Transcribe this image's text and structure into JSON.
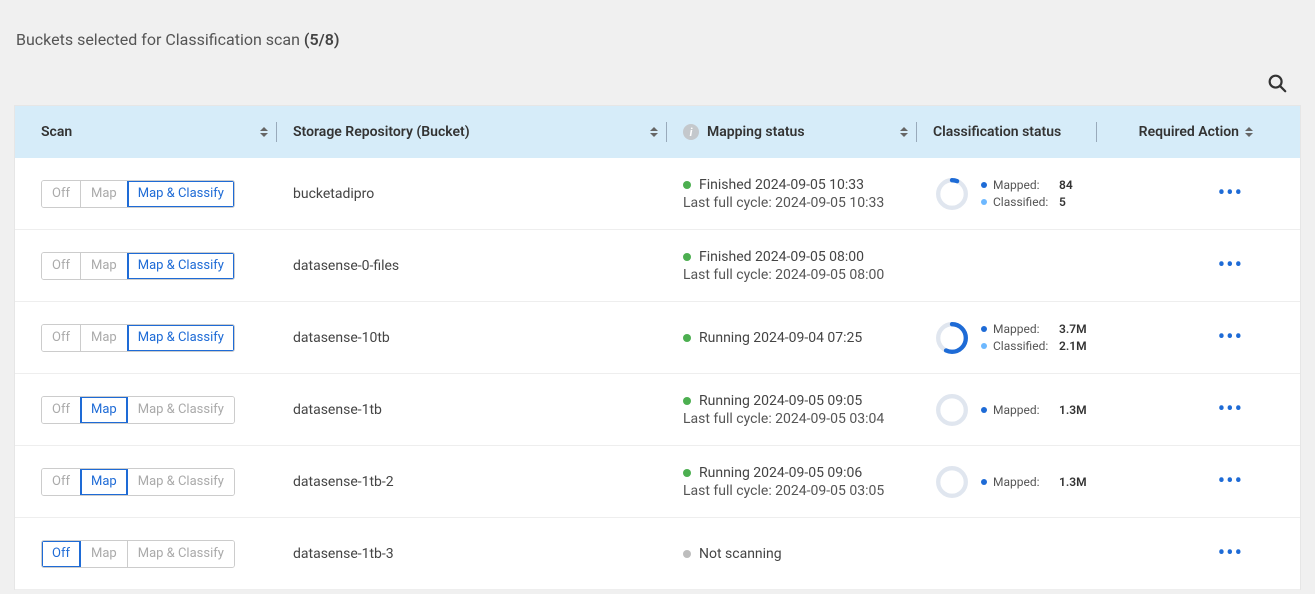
{
  "header": {
    "title_prefix": "Buckets selected for Classification scan ",
    "count": "(5/8)"
  },
  "columns": {
    "scan": "Scan",
    "repo": "Storage Repository (Bucket)",
    "map": "Mapping status",
    "class": "Classification status",
    "action": "Required Action"
  },
  "scan_labels": {
    "off": "Off",
    "map": "Map",
    "map_classify": "Map & Classify"
  },
  "status_words": {
    "finished": "Finished",
    "running": "Running",
    "not_scanning": "Not scanning",
    "last_full_cycle": "Last full cycle:"
  },
  "stat_labels": {
    "mapped": "Mapped:",
    "classified": "Classified:"
  },
  "rows": [
    {
      "mode": "map_classify",
      "bucket": "bucketadipro",
      "map_status": "finished",
      "map_time": "2024-09-05 10:33",
      "last_cycle": "2024-09-05 10:33",
      "donut_pct": 0.06,
      "mapped": "84",
      "classified": "5"
    },
    {
      "mode": "map_classify",
      "bucket": "datasense-0-files",
      "map_status": "finished",
      "map_time": "2024-09-05 08:00",
      "last_cycle": "2024-09-05 08:00",
      "donut_pct": null,
      "mapped": null,
      "classified": null
    },
    {
      "mode": "map_classify",
      "bucket": "datasense-10tb",
      "map_status": "running",
      "map_time": "2024-09-04 07:25",
      "last_cycle": null,
      "donut_pct": 0.57,
      "mapped": "3.7M",
      "classified": "2.1M"
    },
    {
      "mode": "map",
      "bucket": "datasense-1tb",
      "map_status": "running",
      "map_time": "2024-09-05 09:05",
      "last_cycle": "2024-09-05 03:04",
      "donut_pct": 0.0,
      "mapped": "1.3M",
      "classified": null
    },
    {
      "mode": "map",
      "bucket": "datasense-1tb-2",
      "map_status": "running",
      "map_time": "2024-09-05 09:06",
      "last_cycle": "2024-09-05 03:05",
      "donut_pct": 0.0,
      "mapped": "1.3M",
      "classified": null
    },
    {
      "mode": "off",
      "bucket": "datasense-1tb-3",
      "map_status": "not_scanning",
      "map_time": null,
      "last_cycle": null,
      "donut_pct": null,
      "mapped": null,
      "classified": null
    }
  ]
}
